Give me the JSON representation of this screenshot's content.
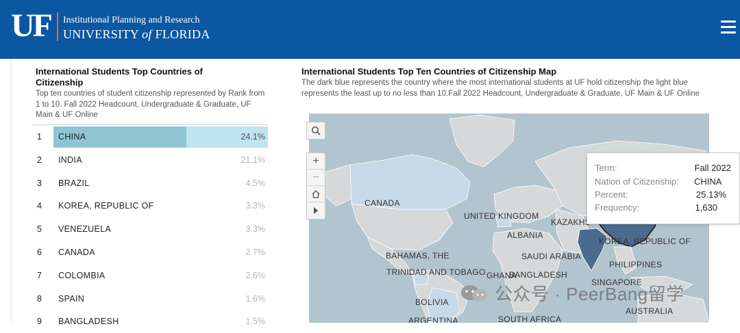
{
  "header": {
    "logo_text": "UF",
    "line1": "Institutional Planning and Research",
    "line2_a": "UNIVERSITY ",
    "line2_of": "of",
    "line2_b": " FLORIDA",
    "brand_color": "#0b57a1",
    "accent_color": "#fa6a0a"
  },
  "left_panel": {
    "title": "International Students Top Countries of Citizenship",
    "subtitle": "Top ten countries of student citizenship represented by Rank from 1 to 10. Fall 2022 Headcount, Undergraduate & Graduate, UF Main & UF Online",
    "rows": [
      {
        "rank": "1",
        "country": "CHINA",
        "percent": "24.1%",
        "value": 24.1
      },
      {
        "rank": "2",
        "country": "INDIA",
        "percent": "21.1%",
        "value": 21.1
      },
      {
        "rank": "3",
        "country": "BRAZIL",
        "percent": "4.5%",
        "value": 4.5
      },
      {
        "rank": "4",
        "country": "KOREA, REPUBLIC OF",
        "percent": "3.3%",
        "value": 3.3
      },
      {
        "rank": "5",
        "country": "VENEZUELA",
        "percent": "3.3%",
        "value": 3.3
      },
      {
        "rank": "6",
        "country": "CANADA",
        "percent": "2.7%",
        "value": 2.7
      },
      {
        "rank": "7",
        "country": "COLOMBIA",
        "percent": "2.6%",
        "value": 2.6
      },
      {
        "rank": "8",
        "country": "SPAIN",
        "percent": "1.6%",
        "value": 1.6
      },
      {
        "rank": "9",
        "country": "BANGLADESH",
        "percent": "1.5%",
        "value": 1.5
      }
    ]
  },
  "right_panel": {
    "title": "International Students Top Ten Countries of Citizenship Map",
    "subtitle": "The dark blue represents the country where the most international students at UF hold citizenship the light blue represents the least up to no less than 10.Fall 2022 Headcount, Undergraduate & Graduate, UF Main & UF Online",
    "map_labels": [
      "CANADA",
      "UNITED KINGDOM",
      "KAZAKHS",
      "ALBANIA",
      "KOREA, REPUBLIC OF",
      "BAHAMAS, THE",
      "SAUDI ARABIA",
      "PHILIPPINES",
      "TRINIDAD AND TOBAGO",
      "GHANA",
      "BANGLADESH",
      "SINGAPORE",
      "BOLIVIA",
      "AUSTRALIA",
      "ARGENTINA",
      "SOUTH AFRICA"
    ],
    "controls": [
      "search-icon",
      "zoom-in-icon",
      "zoom-out-icon",
      "home-icon",
      "play-icon"
    ]
  },
  "tooltip": {
    "term_label": "Term:",
    "term_value": "Fall 2022",
    "nation_label": "Nation of Citizenship:",
    "nation_value": "CHINA",
    "percent_label": "Percent:",
    "percent_value": "25.13%",
    "freq_label": "Frequency:",
    "freq_value": "1,630"
  },
  "watermark": "公众号 · PeerBang留学",
  "colors": {
    "top_bar": "#8fc5d3",
    "bar_bg": "#bfe3f0",
    "ocean": "#b2c4ce",
    "land": "#d5d9da",
    "country_light": "#c6d9e8",
    "country_dark": "#4c6a8e"
  }
}
